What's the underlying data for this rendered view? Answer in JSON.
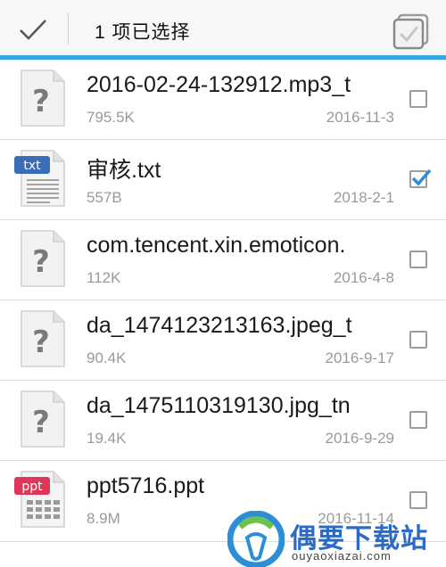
{
  "header": {
    "title": "1 项已选择",
    "done_icon": "check-icon",
    "select_all_icon": "select-all-icon"
  },
  "files": [
    {
      "name": "2016-02-24-132912.mp3_t",
      "size": "795.5K",
      "date": "2016-11-3",
      "icon": "unknown-file-icon",
      "checked": false
    },
    {
      "name": "审核.txt",
      "size": "557B",
      "date": "2018-2-1",
      "icon": "txt-file-icon",
      "checked": true
    },
    {
      "name": "com.tencent.xin.emoticon.",
      "size": "112K",
      "date": "2016-4-8",
      "icon": "unknown-file-icon",
      "checked": false
    },
    {
      "name": "da_1474123213163.jpeg_t",
      "size": "90.4K",
      "date": "2016-9-17",
      "icon": "unknown-file-icon",
      "checked": false
    },
    {
      "name": "da_1475110319130.jpg_tn",
      "size": "19.4K",
      "date": "2016-9-29",
      "icon": "unknown-file-icon",
      "checked": false
    },
    {
      "name": "ppt5716.ppt",
      "size": "8.9M",
      "date": "2016-11-14",
      "icon": "ppt-file-icon",
      "checked": false
    }
  ],
  "icon_labels": {
    "txt": "txt",
    "ppt": "ppt"
  },
  "watermark": {
    "text": "偶要下载站",
    "url": "ouyaoxiazai.com"
  },
  "colors": {
    "accent": "#34a7e0",
    "check": "#2a8fd6",
    "watermark": "#2c6bc4"
  }
}
